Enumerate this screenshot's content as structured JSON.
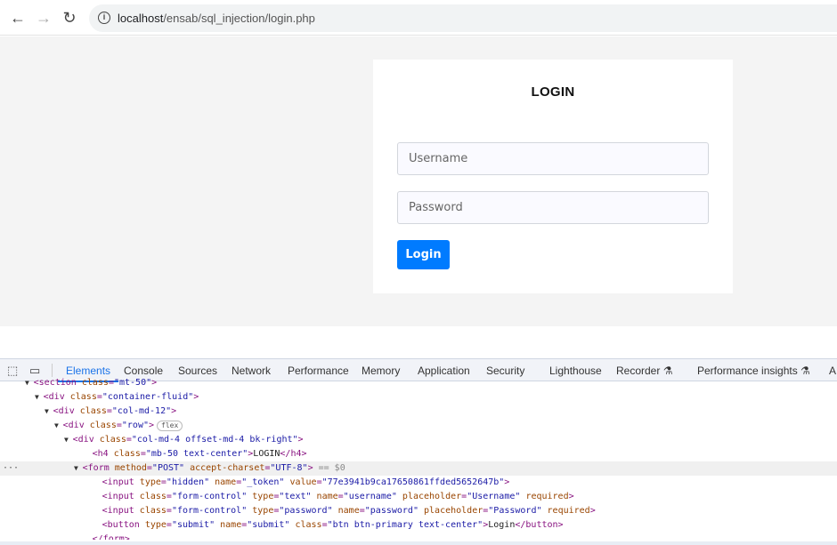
{
  "browser": {
    "url_host": "localhost",
    "url_path": "/ensab/sql_injection/login.php",
    "icons": [
      "back-arrow-icon",
      "forward-arrow-icon",
      "reload-icon",
      "info-icon"
    ]
  },
  "login": {
    "title": "LOGIN",
    "username_placeholder": "Username",
    "password_placeholder": "Password",
    "button_label": "Login",
    "accent": "#007bff"
  },
  "devtools": {
    "tabs": [
      "Elements",
      "Console",
      "Sources",
      "Network",
      "Performance",
      "Memory",
      "Application",
      "Security",
      "Lighthouse",
      "Recorder ⚗",
      "Performance insights ⚗",
      "A"
    ],
    "active_tab": "Elements",
    "badge": "flex",
    "selected_marker": "== $0",
    "lines": [
      {
        "indent": 2,
        "arrow": "▼",
        "parts": [
          [
            "tag",
            "<section "
          ],
          [
            "an",
            "class"
          ],
          [
            "tag",
            "="
          ],
          [
            "av",
            "\"mt-50\""
          ],
          [
            "tag",
            ">"
          ]
        ]
      },
      {
        "indent": 3,
        "arrow": "▼",
        "parts": [
          [
            "tag",
            "<div "
          ],
          [
            "an",
            "class"
          ],
          [
            "tag",
            "="
          ],
          [
            "av",
            "\"container-fluid\""
          ],
          [
            "tag",
            ">"
          ]
        ]
      },
      {
        "indent": 4,
        "arrow": "▼",
        "parts": [
          [
            "tag",
            "<div "
          ],
          [
            "an",
            "class"
          ],
          [
            "tag",
            "="
          ],
          [
            "av",
            "\"col-md-12\""
          ],
          [
            "tag",
            ">"
          ]
        ]
      },
      {
        "indent": 5,
        "arrow": "▼",
        "parts": [
          [
            "tag",
            "<div "
          ],
          [
            "an",
            "class"
          ],
          [
            "tag",
            "="
          ],
          [
            "av",
            "\"row\""
          ],
          [
            "tag",
            ">"
          ]
        ],
        "badge": true
      },
      {
        "indent": 6,
        "arrow": "▼",
        "parts": [
          [
            "tag",
            "<div "
          ],
          [
            "an",
            "class"
          ],
          [
            "tag",
            "="
          ],
          [
            "av",
            "\"col-md-4 offset-md-4 bk-right\""
          ],
          [
            "tag",
            ">"
          ]
        ]
      },
      {
        "indent": 8,
        "arrow": "",
        "parts": [
          [
            "tag",
            "<h4 "
          ],
          [
            "an",
            "class"
          ],
          [
            "tag",
            "="
          ],
          [
            "av",
            "\"mb-50 text-center\""
          ],
          [
            "tag",
            ">"
          ],
          [
            "tx",
            "LOGIN"
          ],
          [
            "tag",
            "</h4>"
          ]
        ]
      },
      {
        "indent": 7,
        "arrow": "▼",
        "sel": true,
        "parts": [
          [
            "tag",
            "<form "
          ],
          [
            "an",
            "method"
          ],
          [
            "tag",
            "="
          ],
          [
            "av",
            "\"POST\""
          ],
          [
            "tag",
            " "
          ],
          [
            "an",
            "accept-charset"
          ],
          [
            "tag",
            "="
          ],
          [
            "av",
            "\"UTF-8\""
          ],
          [
            "tag",
            ">"
          ]
        ]
      },
      {
        "indent": 9,
        "arrow": "",
        "parts": [
          [
            "tag",
            "<input "
          ],
          [
            "an",
            "type"
          ],
          [
            "tag",
            "="
          ],
          [
            "av",
            "\"hidden\""
          ],
          [
            "tag",
            " "
          ],
          [
            "an",
            "name"
          ],
          [
            "tag",
            "="
          ],
          [
            "av",
            "\"_token\""
          ],
          [
            "tag",
            " "
          ],
          [
            "an",
            "value"
          ],
          [
            "tag",
            "="
          ],
          [
            "av",
            "\"77e3941b9ca17650861ffded5652647b\""
          ],
          [
            "tag",
            ">"
          ]
        ]
      },
      {
        "indent": 9,
        "arrow": "",
        "parts": [
          [
            "tag",
            "<input "
          ],
          [
            "an",
            "class"
          ],
          [
            "tag",
            "="
          ],
          [
            "av",
            "\"form-control\""
          ],
          [
            "tag",
            " "
          ],
          [
            "an",
            "type"
          ],
          [
            "tag",
            "="
          ],
          [
            "av",
            "\"text\""
          ],
          [
            "tag",
            " "
          ],
          [
            "an",
            "name"
          ],
          [
            "tag",
            "="
          ],
          [
            "av",
            "\"username\""
          ],
          [
            "tag",
            " "
          ],
          [
            "an",
            "placeholder"
          ],
          [
            "tag",
            "="
          ],
          [
            "av",
            "\"Username\""
          ],
          [
            "tag",
            " "
          ],
          [
            "an",
            "required"
          ],
          [
            "tag",
            ">"
          ]
        ]
      },
      {
        "indent": 9,
        "arrow": "",
        "parts": [
          [
            "tag",
            "<input "
          ],
          [
            "an",
            "class"
          ],
          [
            "tag",
            "="
          ],
          [
            "av",
            "\"form-control\""
          ],
          [
            "tag",
            " "
          ],
          [
            "an",
            "type"
          ],
          [
            "tag",
            "="
          ],
          [
            "av",
            "\"password\""
          ],
          [
            "tag",
            " "
          ],
          [
            "an",
            "name"
          ],
          [
            "tag",
            "="
          ],
          [
            "av",
            "\"password\""
          ],
          [
            "tag",
            " "
          ],
          [
            "an",
            "placeholder"
          ],
          [
            "tag",
            "="
          ],
          [
            "av",
            "\"Password\""
          ],
          [
            "tag",
            " "
          ],
          [
            "an",
            "required"
          ],
          [
            "tag",
            ">"
          ]
        ]
      },
      {
        "indent": 9,
        "arrow": "",
        "parts": [
          [
            "tag",
            "<button "
          ],
          [
            "an",
            "type"
          ],
          [
            "tag",
            "="
          ],
          [
            "av",
            "\"submit\""
          ],
          [
            "tag",
            " "
          ],
          [
            "an",
            "name"
          ],
          [
            "tag",
            "="
          ],
          [
            "av",
            "\"submit\""
          ],
          [
            "tag",
            " "
          ],
          [
            "an",
            "class"
          ],
          [
            "tag",
            "="
          ],
          [
            "av",
            "\"btn btn-primary text-center\""
          ],
          [
            "tag",
            ">"
          ],
          [
            "tx",
            "Login"
          ],
          [
            "tag",
            "</button>"
          ]
        ]
      },
      {
        "indent": 8,
        "arrow": "",
        "parts": [
          [
            "tag",
            "</form>"
          ]
        ]
      }
    ]
  }
}
